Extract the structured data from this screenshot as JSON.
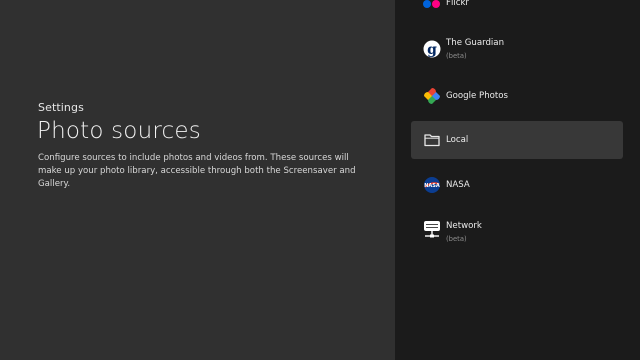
{
  "header": {
    "breadcrumb": "Settings",
    "title": "Photo sources",
    "description": "Configure sources to include photos and videos from. These sources will make up your photo library, accessible through both the Screensaver and Gallery."
  },
  "sources": [
    {
      "label": "Flickr",
      "sublabel": "",
      "icon": "flickr-icon"
    },
    {
      "label": "The Guardian",
      "sublabel": "(beta)",
      "icon": "guardian-icon"
    },
    {
      "label": "Google Photos",
      "sublabel": "",
      "icon": "google-photos-icon"
    },
    {
      "label": "Local",
      "sublabel": "",
      "icon": "folder-icon",
      "focused": true
    },
    {
      "label": "NASA",
      "sublabel": "",
      "icon": "nasa-icon"
    },
    {
      "label": "Network",
      "sublabel": "(beta)",
      "icon": "network-drive-icon"
    }
  ],
  "colors": {
    "left_background": "#303030",
    "right_background": "#1b1b1b",
    "focus_background": "#383838",
    "flickr_blue": "#0063dc",
    "flickr_pink": "#ff0084"
  }
}
